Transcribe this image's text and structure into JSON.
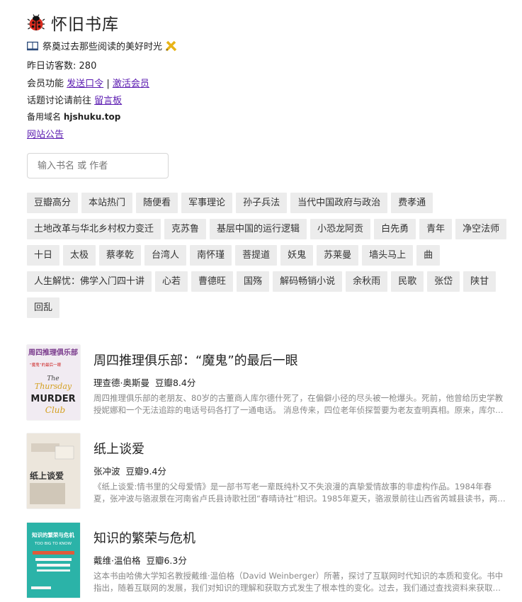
{
  "site": {
    "title": "怀旧书库",
    "icon": "ladybug-icon",
    "tagline": "祭奠过去那些阅读的美好时光",
    "visitors_label": "昨日访客数:",
    "visitors_count": "280",
    "member_label": "会员功能",
    "send_password": "发送口令",
    "separator": "|",
    "activate_member": "激活会员",
    "discuss_label": "话题讨论请前往",
    "message_board": "留言板",
    "backup_domain_label": "备用域名",
    "backup_domain": "hjshuku.top",
    "announcement": "网站公告"
  },
  "search": {
    "placeholder": "输入书名 或 作者"
  },
  "tags": [
    "豆瓣高分",
    "本站热门",
    "随便看",
    "军事理论",
    "孙子兵法",
    "当代中国政府与政治",
    "费孝通",
    "土地改革与华北乡村权力变迁",
    "克苏鲁",
    "基层中国的运行逻辑",
    "小恐龙阿贡",
    "白先勇",
    "青年",
    "净空法师",
    "十日",
    "太极",
    "蔡孝乾",
    "台湾人",
    "南怀瑾",
    "菩提道",
    "妖鬼",
    "苏莱曼",
    "墙头马上",
    "曲",
    "人生解忧：佛学入门四十讲",
    "心若",
    "曹德旺",
    "国殇",
    "解码畅销小说",
    "余秋雨",
    "民歌",
    "张岱",
    "陕甘",
    "回乱"
  ],
  "books": [
    {
      "title": "周四推理俱乐部：“魔鬼”的最后一眼",
      "author": "理查德·奥斯曼",
      "rating": "豆瓣8.4分",
      "desc": "周四推理俱乐部的老朋友、80岁的古董商人库尔德什死了，在偏僻小径的尽头被一枪爆头。死前，他曾给历史学教授妮娜和一个无法追踪的电话号码各打了一通电话。 消息传来，四位老年侦探誓要为老友查明真相。原来，库尔德什生前卷入了一桩危险的交易……",
      "cover": {
        "title_cn": "周四推理俱乐部",
        "sub": "“魔鬼”的最后一眼",
        "en1": "The",
        "en2": "Thursday",
        "en3": "MURDER",
        "en4": "Club",
        "bg": "#f1ebf2",
        "accent": "#7a3a8c"
      }
    },
    {
      "title": "纸上谈爱",
      "author": "张冲波",
      "rating": "豆瓣9.4分",
      "desc": "《纸上谈爱:情书里的父母爱情》是一部书写老一辈既纯朴又不失浪漫的真挚爱情故事的非虚构作品。1984年春夏，张冲波与骆淑景在河南省卢氏县诗歌社团“春晴诗社”相识。1985年夏天，骆淑景前往山西省芮城县读书，两人开始了长达数年的书信往来……",
      "cover": {
        "cover_text": "纸上谈爱",
        "bg": "#ece6dc",
        "accent": "#333333"
      }
    },
    {
      "title": "知识的繁荣与危机",
      "author": "戴维·温伯格",
      "rating": "豆瓣6.3分",
      "desc": "这本书由哈佛大学知名教授戴维·温伯格（David Weinberger）所著，探讨了互联网时代知识的本质和变化。书中指出，随着互联网的发展，我们对知识的理解和获取方式发生了根本性的变化。过去，我们通过查找资料来获取知识……",
      "cover": {
        "title_cn": "知识的繁荣与危机",
        "en": "TOO BIG TO KNOW",
        "bg": "#2bb3a8",
        "accent": "#ffffff"
      }
    }
  ]
}
